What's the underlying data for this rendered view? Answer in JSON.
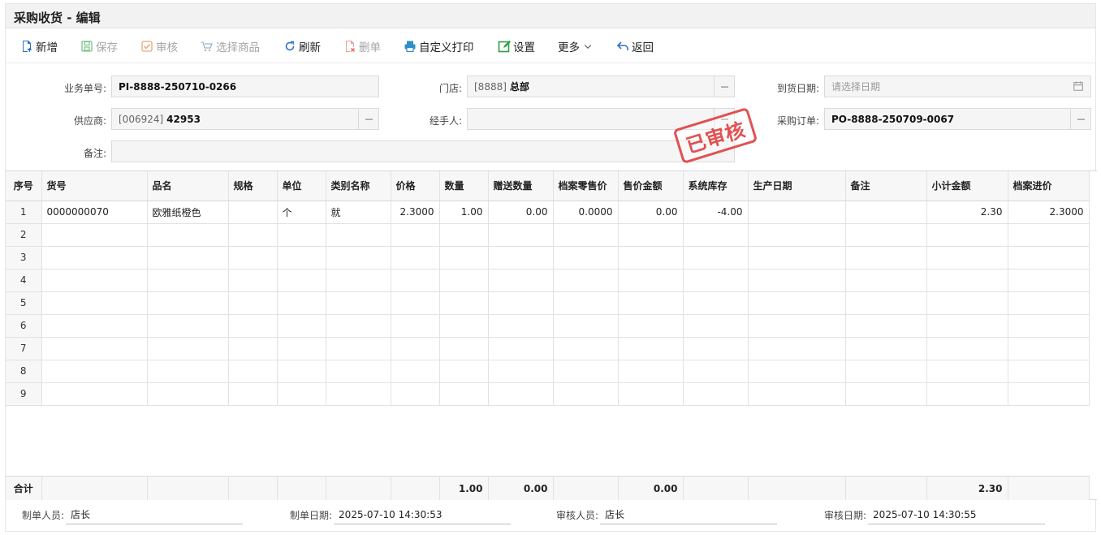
{
  "window": {
    "title": "采购收货 - 编辑"
  },
  "toolbar": {
    "new": "新增",
    "save": "保存",
    "audit": "审核",
    "select_goods": "选择商品",
    "refresh": "刷新",
    "delete": "删单",
    "custom_print": "自定义打印",
    "settings": "设置",
    "more": "更多",
    "back": "返回"
  },
  "form": {
    "order_no_label": "业务单号:",
    "order_no": "PI-8888-250710-0266",
    "store_label": "门店:",
    "store_code": "[8888]",
    "store_name": "总部",
    "arrival_label": "到货日期:",
    "arrival_placeholder": "请选择日期",
    "supplier_label": "供应商:",
    "supplier_code": "[006924]",
    "supplier_name": "42953",
    "handler_label": "经手人:",
    "handler": "",
    "po_label": "采购订单:",
    "po_no": "PO-8888-250709-0067",
    "remark_label": "备注:",
    "remark": "",
    "dots": "---"
  },
  "stamp": "已审核",
  "table": {
    "columns": [
      "序号",
      "货号",
      "品名",
      "规格",
      "单位",
      "类别名称",
      "价格",
      "数量",
      "赠送数量",
      "档案零售价",
      "售价金额",
      "系统库存",
      "生产日期",
      "备注",
      "小计金额",
      "档案进价"
    ],
    "rows": [
      [
        "1",
        "0000000070",
        "欧雅纸橙色",
        "",
        "个",
        "就",
        "2.3000",
        "1.00",
        "0.00",
        "0.0000",
        "0.00",
        "-4.00",
        "",
        "",
        "2.30",
        "2.3000"
      ],
      [
        "2",
        "",
        "",
        "",
        "",
        "",
        "",
        "",
        "",
        "",
        "",
        "",
        "",
        "",
        "",
        ""
      ],
      [
        "3",
        "",
        "",
        "",
        "",
        "",
        "",
        "",
        "",
        "",
        "",
        "",
        "",
        "",
        "",
        ""
      ],
      [
        "4",
        "",
        "",
        "",
        "",
        "",
        "",
        "",
        "",
        "",
        "",
        "",
        "",
        "",
        "",
        ""
      ],
      [
        "5",
        "",
        "",
        "",
        "",
        "",
        "",
        "",
        "",
        "",
        "",
        "",
        "",
        "",
        "",
        ""
      ],
      [
        "6",
        "",
        "",
        "",
        "",
        "",
        "",
        "",
        "",
        "",
        "",
        "",
        "",
        "",
        "",
        ""
      ],
      [
        "7",
        "",
        "",
        "",
        "",
        "",
        "",
        "",
        "",
        "",
        "",
        "",
        "",
        "",
        "",
        ""
      ],
      [
        "8",
        "",
        "",
        "",
        "",
        "",
        "",
        "",
        "",
        "",
        "",
        "",
        "",
        "",
        "",
        ""
      ],
      [
        "9",
        "",
        "",
        "",
        "",
        "",
        "",
        "",
        "",
        "",
        "",
        "",
        "",
        "",
        "",
        ""
      ]
    ],
    "totals": [
      "合计",
      "",
      "",
      "",
      "",
      "",
      "",
      "1.00",
      "0.00",
      "",
      "0.00",
      "",
      "",
      "",
      "2.30",
      ""
    ]
  },
  "footer": {
    "maker_label": "制单人员:",
    "maker": "店长",
    "make_date_label": "制单日期:",
    "make_date": "2025-07-10 14:30:53",
    "auditor_label": "审核人员:",
    "auditor": "店长",
    "audit_date_label": "审核日期:",
    "audit_date": "2025-07-10 14:30:55"
  },
  "colors": {
    "primary_blue": "#2f6fc9",
    "green": "#2ea043",
    "stamp_red": "#e03a3a"
  }
}
